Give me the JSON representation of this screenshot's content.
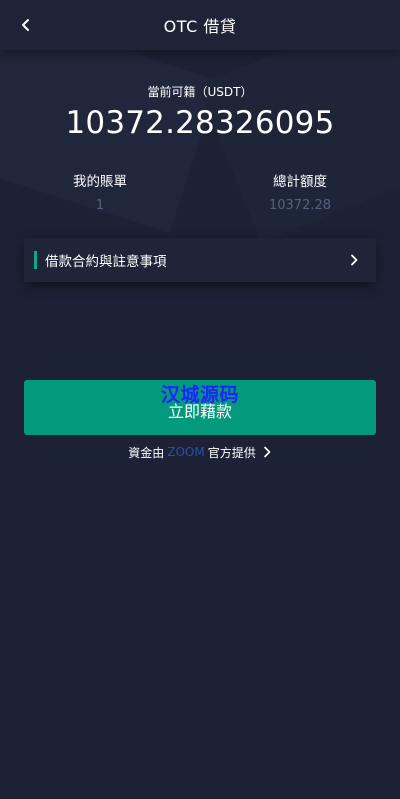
{
  "header": {
    "title": "OTC 借貸",
    "back_icon": "chevron-left-icon"
  },
  "balance": {
    "label": "當前可籍（USDT）",
    "value": "10372.28326095"
  },
  "stats": {
    "my_bill": {
      "label": "我的賬單",
      "value": "1"
    },
    "total_quota": {
      "label": "總計額度",
      "value": "10372.28"
    }
  },
  "notice": {
    "label": "借款合約與註意事項",
    "icon": "chevron-right-icon"
  },
  "cta": {
    "label": "立即藉款",
    "watermark": "汉城源码"
  },
  "provider": {
    "prefix": "資金由",
    "brand": "ZOOM",
    "suffix": "官方提供",
    "icon": "chevron-right-icon"
  },
  "colors": {
    "background": "#1c2136",
    "accent": "#02997c",
    "brand": "#2a4ea8",
    "muted": "#56607f"
  }
}
